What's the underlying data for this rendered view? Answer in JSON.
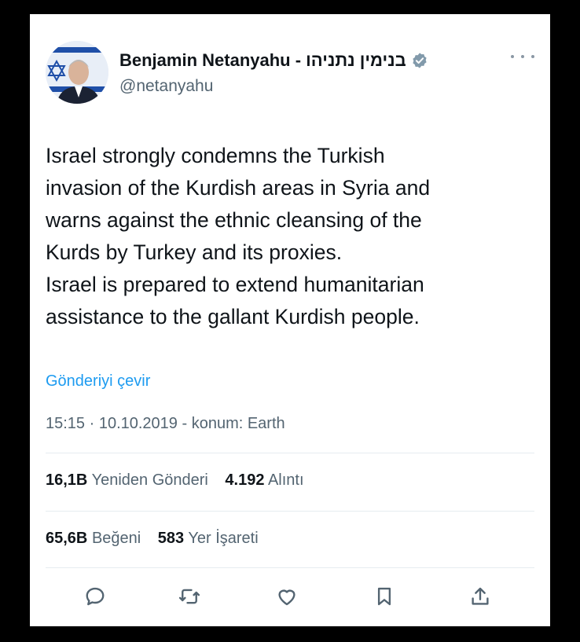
{
  "tweet": {
    "author": {
      "display_name": "Benjamin Netanyahu - בנימין נתניהו",
      "handle": "@netanyahu",
      "verified_icon": "verified-badge-icon"
    },
    "text": "Israel strongly condemns the Turkish\ninvasion of the Kurdish areas in Syria and\nwarns against the ethnic cleansing of the\nKurds by Turkey and its proxies.\nIsrael is prepared to extend humanitarian\nassistance to the gallant Kurdish people.",
    "translate_label": "Gönderiyi çevir",
    "timestamp": "15:15 · 10.10.2019 - konum: Earth",
    "stats": {
      "retweets_count": "16,1B",
      "retweets_label": "Yeniden Gönderi",
      "quotes_count": "4.192",
      "quotes_label": "Alıntı",
      "likes_count": "65,6B",
      "likes_label": "Beğeni",
      "bookmarks_count": "583",
      "bookmarks_label": "Yer İşareti"
    },
    "actions": [
      "reply-icon",
      "retweet-icon",
      "like-icon",
      "bookmark-icon",
      "share-icon"
    ]
  },
  "colors": {
    "text": "#0f1419",
    "secondary": "#536471",
    "link": "#1d9bf0",
    "icon": "#536471",
    "verified": "#829aab"
  }
}
